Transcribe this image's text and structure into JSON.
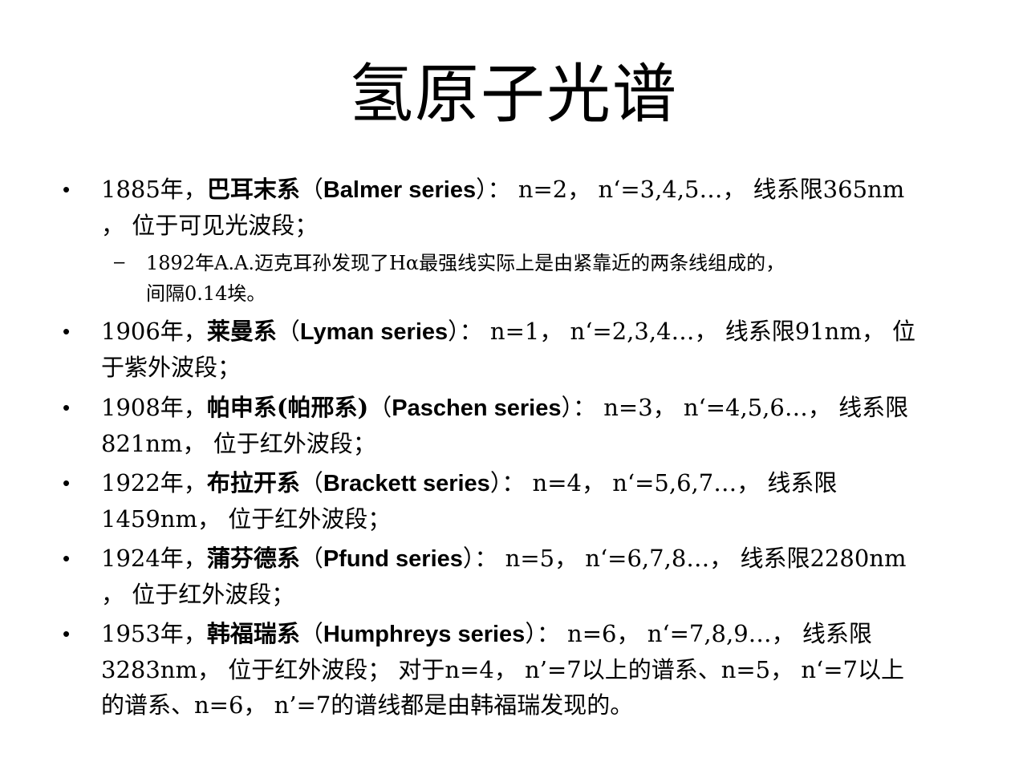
{
  "title": "氢原子光谱",
  "items": [
    {
      "marker": "•",
      "line1": {
        "year": "1885年，",
        "series_cn": "巴耳末系",
        "open_paren": "（",
        "series_en": "Balmer series",
        "close_paren": "）",
        "rest": "： n=2， n‘=3,4,5…， 线系限365nm"
      },
      "line2": "， 位于可见光波段；"
    },
    {
      "marker": "–",
      "line1": "1892年A.A.迈克耳孙发现了Hα最强线实际上是由紧靠近的两条线组成的，",
      "line2": "间隔0.14埃。"
    },
    {
      "marker": "•",
      "line1": {
        "year": "1906年，",
        "series_cn": "莱曼系",
        "open_paren": "（",
        "series_en": "Lyman series",
        "close_paren": "）",
        "rest": "： n=1， n‘=2,3,4…， 线系限91nm， 位"
      },
      "line2": "于紫外波段；"
    },
    {
      "marker": "•",
      "line1": {
        "year": "1908年，",
        "series_cn": "帕申系(帕邢系)",
        "open_paren": "（",
        "series_en": "Paschen series",
        "close_paren": "）",
        "rest": "： n=3， n‘=4,5,6…， 线系限"
      },
      "line2": "821nm， 位于红外波段；"
    },
    {
      "marker": "•",
      "line1": {
        "year": "1922年，",
        "series_cn": "布拉开系",
        "open_paren": "（",
        "series_en": "Brackett series",
        "close_paren": "）",
        "rest": "： n=4， n‘=5,6,7…， 线系限"
      },
      "line2": "1459nm， 位于红外波段；"
    },
    {
      "marker": "•",
      "line1": {
        "year": "1924年，",
        "series_cn": "蒲芬德系",
        "open_paren": "（",
        "series_en": "Pfund series",
        "close_paren": "）",
        "rest": "： n=5， n‘=6,7,8…， 线系限2280nm"
      },
      "line2": "， 位于红外波段；"
    },
    {
      "marker": "•",
      "line1": {
        "year": "1953年，",
        "series_cn": "韩福瑞系",
        "open_paren": "（",
        "series_en": "Humphreys series",
        "close_paren": "）",
        "rest": "： n=6， n‘=7,8,9…， 线系限"
      },
      "line2": "3283nm， 位于红外波段； 对于n=4， n’=7以上的谱系、n=5， n‘=7以上",
      "line3": "的谱系、n=6， n’=7的谱线都是由韩福瑞发现的。"
    }
  ]
}
